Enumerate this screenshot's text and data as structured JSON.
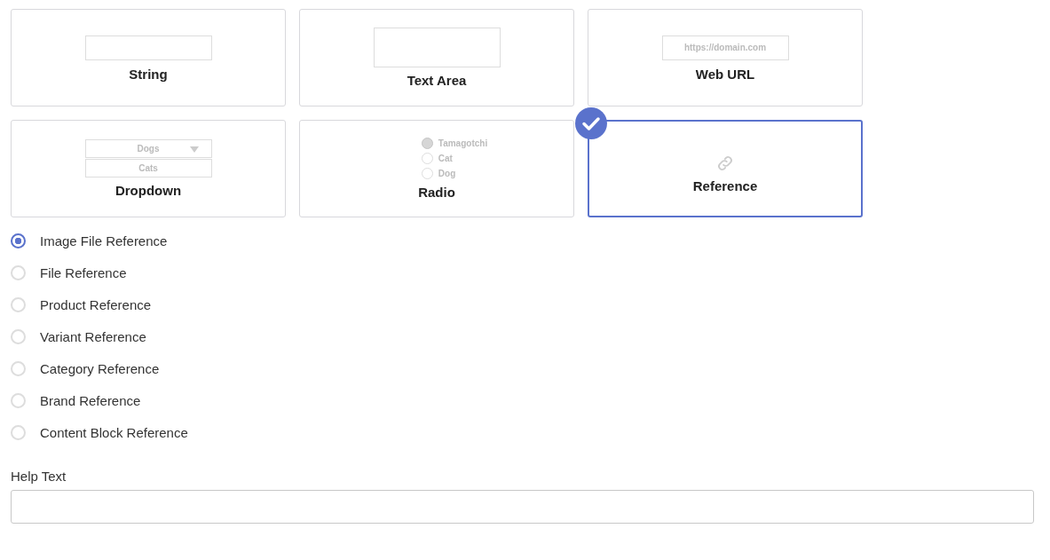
{
  "field_types": [
    {
      "kind": "string",
      "label": "String",
      "selected": false
    },
    {
      "kind": "textarea",
      "label": "Text Area",
      "selected": false
    },
    {
      "kind": "url",
      "label": "Web URL",
      "selected": false,
      "placeholder": "https://domain.com"
    },
    {
      "kind": "dropdown",
      "label": "Dropdown",
      "selected": false,
      "value": "Dogs",
      "option": "Cats"
    },
    {
      "kind": "radio",
      "label": "Radio",
      "selected": false,
      "options": [
        {
          "label": "Tamagotchi",
          "selected": true
        },
        {
          "label": "Cat",
          "selected": false
        },
        {
          "label": "Dog",
          "selected": false
        }
      ]
    },
    {
      "kind": "reference",
      "label": "Reference",
      "selected": true
    }
  ],
  "reference_types": [
    {
      "label": "Image File Reference",
      "selected": true
    },
    {
      "label": "File Reference",
      "selected": false
    },
    {
      "label": "Product Reference",
      "selected": false
    },
    {
      "label": "Variant Reference",
      "selected": false
    },
    {
      "label": "Category Reference",
      "selected": false
    },
    {
      "label": "Brand Reference",
      "selected": false
    },
    {
      "label": "Content Block Reference",
      "selected": false
    }
  ],
  "help_text": {
    "label": "Help Text"
  }
}
